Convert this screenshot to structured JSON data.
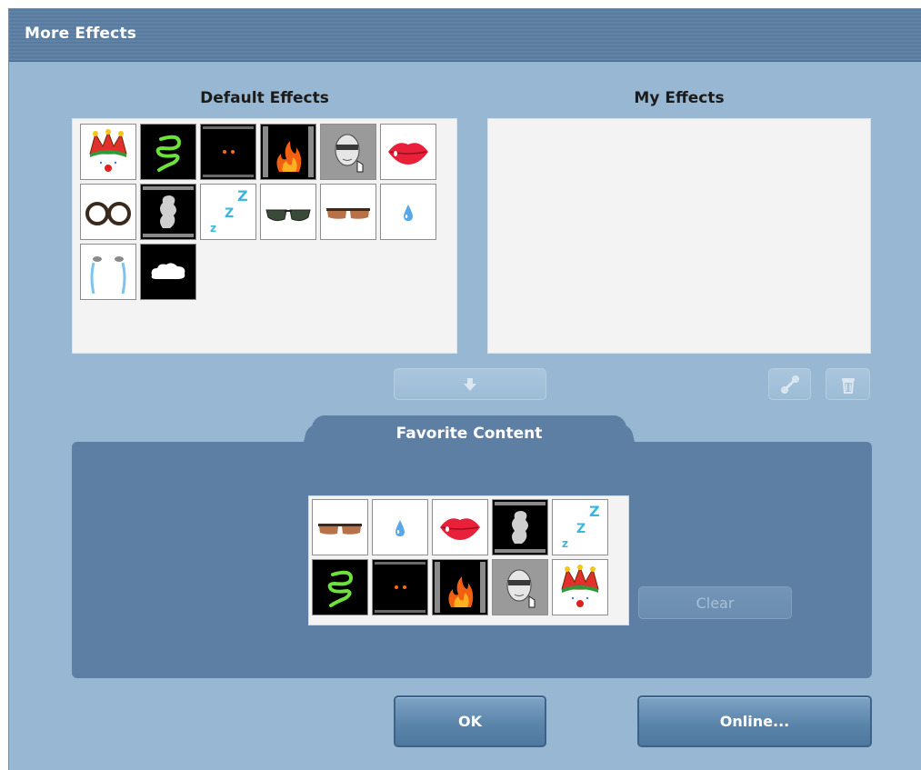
{
  "window": {
    "title": "More Effects"
  },
  "default_effects": {
    "title": "Default Effects",
    "items": [
      {
        "name": "jester-hat-clown-nose",
        "icon": "jester-icon"
      },
      {
        "name": "green-spiral",
        "icon": "spiral-icon"
      },
      {
        "name": "glowing-eyes",
        "icon": "glowing-eyes-icon"
      },
      {
        "name": "fire",
        "icon": "fire-icon"
      },
      {
        "name": "head-mask",
        "icon": "head-icon"
      },
      {
        "name": "red-lips",
        "icon": "lips-icon"
      },
      {
        "name": "round-glasses",
        "icon": "round-glasses-icon"
      },
      {
        "name": "smoke",
        "icon": "smoke-icon"
      },
      {
        "name": "sleeping-zzz",
        "icon": "zzz-icon"
      },
      {
        "name": "dark-sunglasses",
        "icon": "sunglasses-icon"
      },
      {
        "name": "brown-sunglasses",
        "icon": "brown-sunglasses-icon"
      },
      {
        "name": "water-drop",
        "icon": "drop-icon"
      },
      {
        "name": "tears",
        "icon": "tears-icon"
      },
      {
        "name": "cloud",
        "icon": "cloud-icon"
      }
    ]
  },
  "my_effects": {
    "title": "My Effects",
    "items": []
  },
  "favorite_content": {
    "title": "Favorite Content",
    "items": [
      {
        "name": "brown-sunglasses",
        "icon": "brown-sunglasses-icon"
      },
      {
        "name": "water-drop",
        "icon": "drop-icon"
      },
      {
        "name": "red-lips",
        "icon": "lips-icon"
      },
      {
        "name": "smoke",
        "icon": "smoke-icon"
      },
      {
        "name": "sleeping-zzz",
        "icon": "zzz-icon"
      },
      {
        "name": "green-spiral",
        "icon": "spiral-icon"
      },
      {
        "name": "glowing-eyes",
        "icon": "glowing-eyes-icon"
      },
      {
        "name": "fire",
        "icon": "fire-icon"
      },
      {
        "name": "head-mask",
        "icon": "head-icon"
      },
      {
        "name": "jester-hat-clown-nose",
        "icon": "jester-icon"
      }
    ]
  },
  "buttons": {
    "add_down": {
      "icon": "arrow-down-icon",
      "state": "disabled"
    },
    "link": {
      "icon": "link-icon",
      "state": "disabled"
    },
    "delete": {
      "icon": "trash-icon",
      "state": "disabled"
    },
    "clear": {
      "label": "Clear",
      "state": "disabled"
    },
    "ok": {
      "label": "OK"
    },
    "online": {
      "label": "Online..."
    }
  },
  "colors": {
    "dialog_bg": "#97b7d2",
    "titlebar": "#577c9f",
    "favorite_bg": "#5c7fa3",
    "panel_bg": "#f3f3f3"
  }
}
